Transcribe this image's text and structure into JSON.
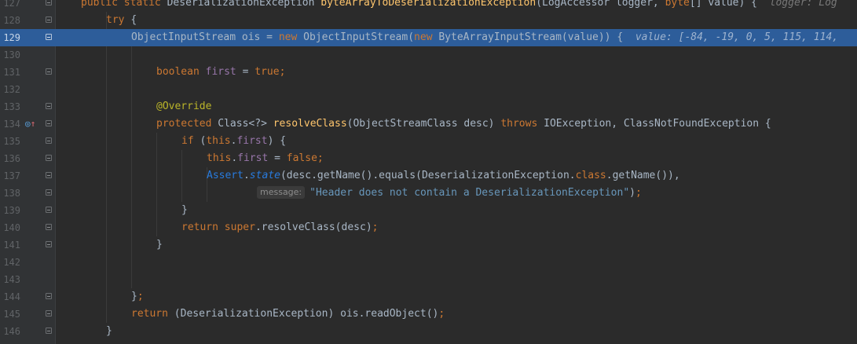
{
  "editor": {
    "lines": [
      {
        "num": "127",
        "tokens": [
          [
            "kw",
            "public "
          ],
          [
            "kw",
            "static "
          ],
          [
            "pln",
            "DeserializationException "
          ],
          [
            "fn",
            "byteArrayToDeserializationException"
          ],
          [
            "pln",
            "(LogAccessor logger, "
          ],
          [
            "kw",
            "byte"
          ],
          [
            "pln",
            "[] value) { "
          ]
        ],
        "hint": "logger: Log",
        "indent": 0
      },
      {
        "num": "128",
        "tokens": [
          [
            "kw",
            "try "
          ],
          [
            "pln",
            "{"
          ]
        ],
        "indent": 1
      },
      {
        "num": "129",
        "tokens": [
          [
            "pln",
            "ObjectInputStream ois = "
          ],
          [
            "kw",
            "new "
          ],
          [
            "pln",
            "ObjectInputStream("
          ],
          [
            "kw",
            "new "
          ],
          [
            "pln",
            "ByteArrayInputStream(value)) { "
          ]
        ],
        "hint": "value: [-84, -19, 0, 5, 115, 114,",
        "indent": 2,
        "current": true
      },
      {
        "num": "130",
        "tokens": [],
        "indent": 0
      },
      {
        "num": "131",
        "tokens": [
          [
            "kw",
            "boolean "
          ],
          [
            "fld",
            "first "
          ],
          [
            "pln",
            "= "
          ],
          [
            "kw",
            "true"
          ],
          [
            "kw",
            ";"
          ]
        ],
        "indent": 3
      },
      {
        "num": "132",
        "tokens": [],
        "indent": 0
      },
      {
        "num": "133",
        "tokens": [
          [
            "ann",
            "@Override"
          ]
        ],
        "indent": 3
      },
      {
        "num": "134",
        "tokens": [
          [
            "kw",
            "protected "
          ],
          [
            "pln",
            "Class<?> "
          ],
          [
            "fn",
            "resolveClass"
          ],
          [
            "pln",
            "(ObjectStreamClass desc) "
          ],
          [
            "kw",
            "throws "
          ],
          [
            "pln",
            "IOException, ClassNotFoundException {"
          ]
        ],
        "indent": 3,
        "marker": true
      },
      {
        "num": "135",
        "tokens": [
          [
            "kw",
            "if "
          ],
          [
            "pln",
            "("
          ],
          [
            "kw",
            "this"
          ],
          [
            "pln",
            "."
          ],
          [
            "fld",
            "first"
          ],
          [
            "pln",
            ") {"
          ]
        ],
        "indent": 4
      },
      {
        "num": "136",
        "tokens": [
          [
            "kw",
            "this"
          ],
          [
            "pln",
            "."
          ],
          [
            "fld",
            "first "
          ],
          [
            "pln",
            "= "
          ],
          [
            "kw",
            "false"
          ],
          [
            "kw",
            ";"
          ]
        ],
        "indent": 5
      },
      {
        "num": "137",
        "tokens": [
          [
            "std",
            "Assert"
          ],
          [
            "pln",
            "."
          ],
          [
            "std-i",
            "state"
          ],
          [
            "pln",
            "(desc.getName().equals(DeserializationException."
          ],
          [
            "kw",
            "class"
          ],
          [
            "pln",
            ".getName()),"
          ]
        ],
        "indent": 5
      },
      {
        "num": "138",
        "tokens": [
          [
            "str-blue",
            "\"Header does not contain a DeserializationException\""
          ],
          [
            "pln",
            ")"
          ],
          [
            "kw",
            ";"
          ]
        ],
        "param": "message:",
        "indent": 7
      },
      {
        "num": "139",
        "tokens": [
          [
            "pln",
            "}"
          ]
        ],
        "indent": 4
      },
      {
        "num": "140",
        "tokens": [
          [
            "kw",
            "return "
          ],
          [
            "kw",
            "super"
          ],
          [
            "pln",
            ".resolveClass(desc)"
          ],
          [
            "kw",
            ";"
          ]
        ],
        "indent": 4
      },
      {
        "num": "141",
        "tokens": [
          [
            "pln",
            "}"
          ]
        ],
        "indent": 3
      },
      {
        "num": "142",
        "tokens": [],
        "indent": 0
      },
      {
        "num": "143",
        "tokens": [],
        "indent": 0
      },
      {
        "num": "144",
        "tokens": [
          [
            "pln",
            "}"
          ],
          [
            "kw",
            ";"
          ]
        ],
        "indent": 2
      },
      {
        "num": "145",
        "tokens": [
          [
            "kw",
            "return "
          ],
          [
            "pln",
            "(DeserializationException) ois.readObject()"
          ],
          [
            "kw",
            ";"
          ]
        ],
        "indent": 2
      },
      {
        "num": "146",
        "tokens": [
          [
            "pln",
            "}"
          ]
        ],
        "indent": 1
      }
    ],
    "marker_icons": {
      "override": "override-gutter-icon",
      "arrow": "implements-up-arrow-icon"
    }
  }
}
